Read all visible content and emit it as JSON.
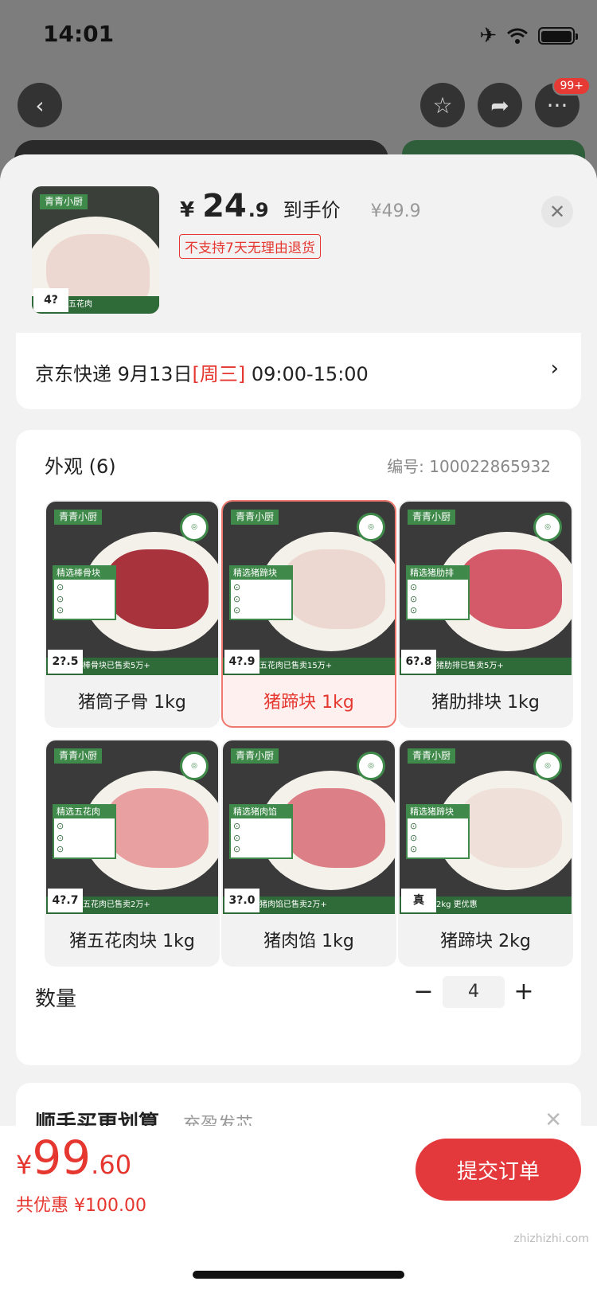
{
  "status_bar": {
    "time": "14:01"
  },
  "nav": {
    "more_badge": "99+"
  },
  "product": {
    "price_yen": "¥",
    "price_int": "24",
    "price_dec": ".9",
    "price_tag": "到手价",
    "original_price": "¥49.9",
    "no_return_notice": "不支持7天无理由退货"
  },
  "delivery": {
    "carrier": "京东快递",
    "date": "9月13日",
    "weekday": "[周三]",
    "time_window": "09:00-15:00"
  },
  "spec": {
    "title": "外观 (6)",
    "code_label": "编号:",
    "code_value": "100022865932",
    "variants": [
      {
        "label": "猪筒子骨 1kg",
        "selected": false,
        "brand": "青青小厨",
        "feature": "精选棒骨块",
        "price": "2?.5",
        "bar": "棒骨块已售卖5万+",
        "meat_color": "#a8333c"
      },
      {
        "label": "猪蹄块 1kg",
        "selected": true,
        "brand": "青青小厨",
        "feature": "精选猪蹄块",
        "price": "4?.9",
        "bar": "五花肉已售卖15万+",
        "meat_color": "#ecd8d0"
      },
      {
        "label": "猪肋排块 1kg",
        "selected": false,
        "brand": "青青小厨",
        "feature": "精选猪肋排",
        "price": "6?.8",
        "bar": "猪肋排已售卖5万+",
        "meat_color": "#d45a6a"
      },
      {
        "label": "猪五花肉块 1kg",
        "selected": false,
        "brand": "青青小厨",
        "feature": "精选五花肉",
        "price": "4?.7",
        "bar": "五花肉已售卖2万+",
        "meat_color": "#e8a0a0"
      },
      {
        "label": "猪肉馅 1kg",
        "selected": false,
        "brand": "青青小厨",
        "feature": "精选猪肉馅",
        "price": "3?.0",
        "bar": "猪肉馅已售卖2万+",
        "meat_color": "#dc7f86"
      },
      {
        "label": "猪蹄块 2kg",
        "selected": false,
        "brand": "青青小厨",
        "feature": "精选猪蹄块",
        "price": "真",
        "bar": "2kg 更优惠",
        "meat_color": "#efe0da"
      }
    ]
  },
  "quantity": {
    "label": "数量",
    "minus": "−",
    "value": "4",
    "plus": "+"
  },
  "addon": {
    "title": "顺手买更划算",
    "subtitle": "充盈发芯"
  },
  "bottom": {
    "total_yen": "¥",
    "total_int": "99",
    "total_dec": ".60",
    "discount": "共优惠 ¥100.00",
    "submit_label": "提交订单"
  },
  "watermark": "zhizhizhi.com"
}
